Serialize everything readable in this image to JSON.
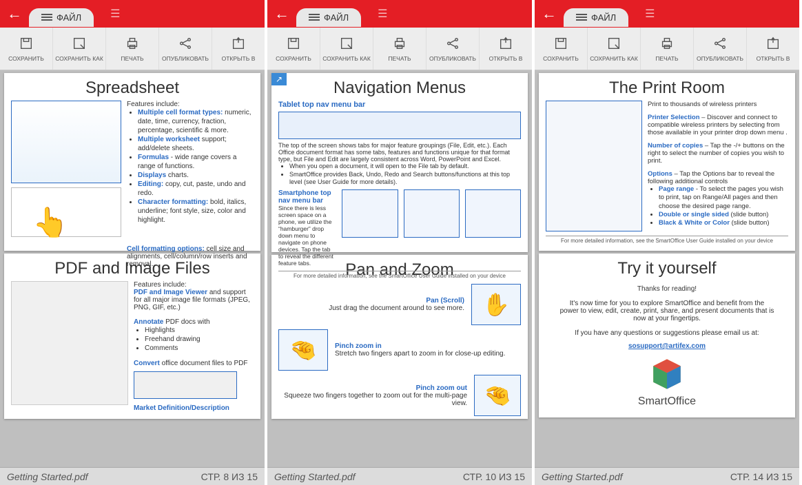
{
  "topbar": {
    "file_tab": "ФАЙЛ"
  },
  "toolbar": {
    "save": "СОХРАНИТЬ",
    "save_as": "СОХРАНИТЬ КАК",
    "print": "ПЕЧАТЬ",
    "publish": "ОПУБЛИКОВАТЬ",
    "open_in": "ОТКРЫТЬ В"
  },
  "status": {
    "filename": "Getting Started.pdf",
    "page1": "СТР. 8 ИЗ 15",
    "page2": "СТР. 10 ИЗ 15",
    "page3": "СТР. 14 ИЗ 15"
  },
  "p1a": {
    "title": "Spreadsheet",
    "intro": "Features include:",
    "b1a": "Multiple cell format types:",
    "b1b": " numeric, date, time, currency, fraction, percentage, scientific & more.",
    "b2a": "Multiple worksheet",
    "b2b": " support; add/delete sheets.",
    "b3a": "Formulas",
    "b3b": " - wide range covers a range of functions.",
    "b4a": "Displays",
    "b4b": " charts.",
    "b5a": "Editing:",
    "b5b": " copy, cut, paste, undo and redo.",
    "b6a": "Character formatting:",
    "b6b": " bold, italics, underline; font style, size, color and highlight.",
    "cfoa": "Cell formatting options:",
    "cfob": " cell size and alignments, cell/column/row inserts and removal."
  },
  "p1b": {
    "title": "PDF and Image Files",
    "intro": "Features include:",
    "v1a": "PDF and Image Viewer",
    "v1b": " and support for all major image file formats (JPEG, PNG, GIF, etc.)",
    "annot": "Annotate",
    "annotb": " PDF docs with",
    "a1": "Highlights",
    "a2": "Freehand drawing",
    "a3": "Comments",
    "conv": "Convert",
    "convb": " office document files to PDF",
    "mdd": "Market Definition/Description"
  },
  "p2a": {
    "title": "Navigation Menus",
    "sub1": "Tablet top nav menu bar",
    "para1": "The top of the screen shows tabs for major feature groupings (File, Edit, etc.). Each Office document format has some tabs, features and functions unique for that format type, but File and Edit are largely consistent across Word, PowerPoint and Excel.",
    "li1": "When you open a document, it will open to the File tab by default.",
    "li2": "SmartOffice provides Back, Undo, Redo and Search buttons/functions at this top level (see User Guide for more details).",
    "sub2": "Smartphone top nav menu bar",
    "para2": "Since there is less screen space on a phone, we utilize the “hamburger” drop down menu to navigate on phone devices. Tap the tab to reveal the different feature tabs.",
    "foot": "For more detailed information, see the SmartOffice User Guide installed on your device"
  },
  "p2b": {
    "title": "Pan and Zoom",
    "pan_h": "Pan (Scroll)",
    "pan_t": "Just drag the document around to see more.",
    "zin_h": "Pinch zoom in",
    "zin_t": "Stretch two fingers apart to zoom in for close-up editing.",
    "zout_h": "Pinch zoom out",
    "zout_t": "Squeeze two fingers together to zoom out for the multi-page view."
  },
  "p3a": {
    "title": "The Print Room",
    "intro": "Print to thousands of wireless printers",
    "ps_h": "Printer Selection",
    "ps_t": " – Discover and connect to compatible wireless printers by selecting from those available in your printer drop down menu .",
    "nc_h": "Number of copies",
    "nc_t": " – Tap the -/+ buttons on the right to select the number of copies you wish to print.",
    "op_h": "Options",
    "op_t": " – Tap the Options bar to reveal the following additional controls",
    "o1a": "Page range",
    "o1b": " - To select the pages you wish to print, tap on Range/All pages and then choose the desired page range.",
    "o2a": "Double or single sided",
    "o2b": " (slide button)",
    "o3a": "Black & White or Color",
    "o3b": " (slide button)",
    "foot": "For more detailed information, see the SmartOffice User Guide installed on your device"
  },
  "p3b": {
    "title": "Try it yourself",
    "l1": "Thanks for reading!",
    "l2": "It's now time for you to explore SmartOffice and benefit from the power to view, edit, create, print, share, and present documents that is now at your fingertips.",
    "l3": "If you have any questions or suggestions please email us at:",
    "email": "sosupport@artifex.com",
    "brand": "SmartOffice"
  }
}
